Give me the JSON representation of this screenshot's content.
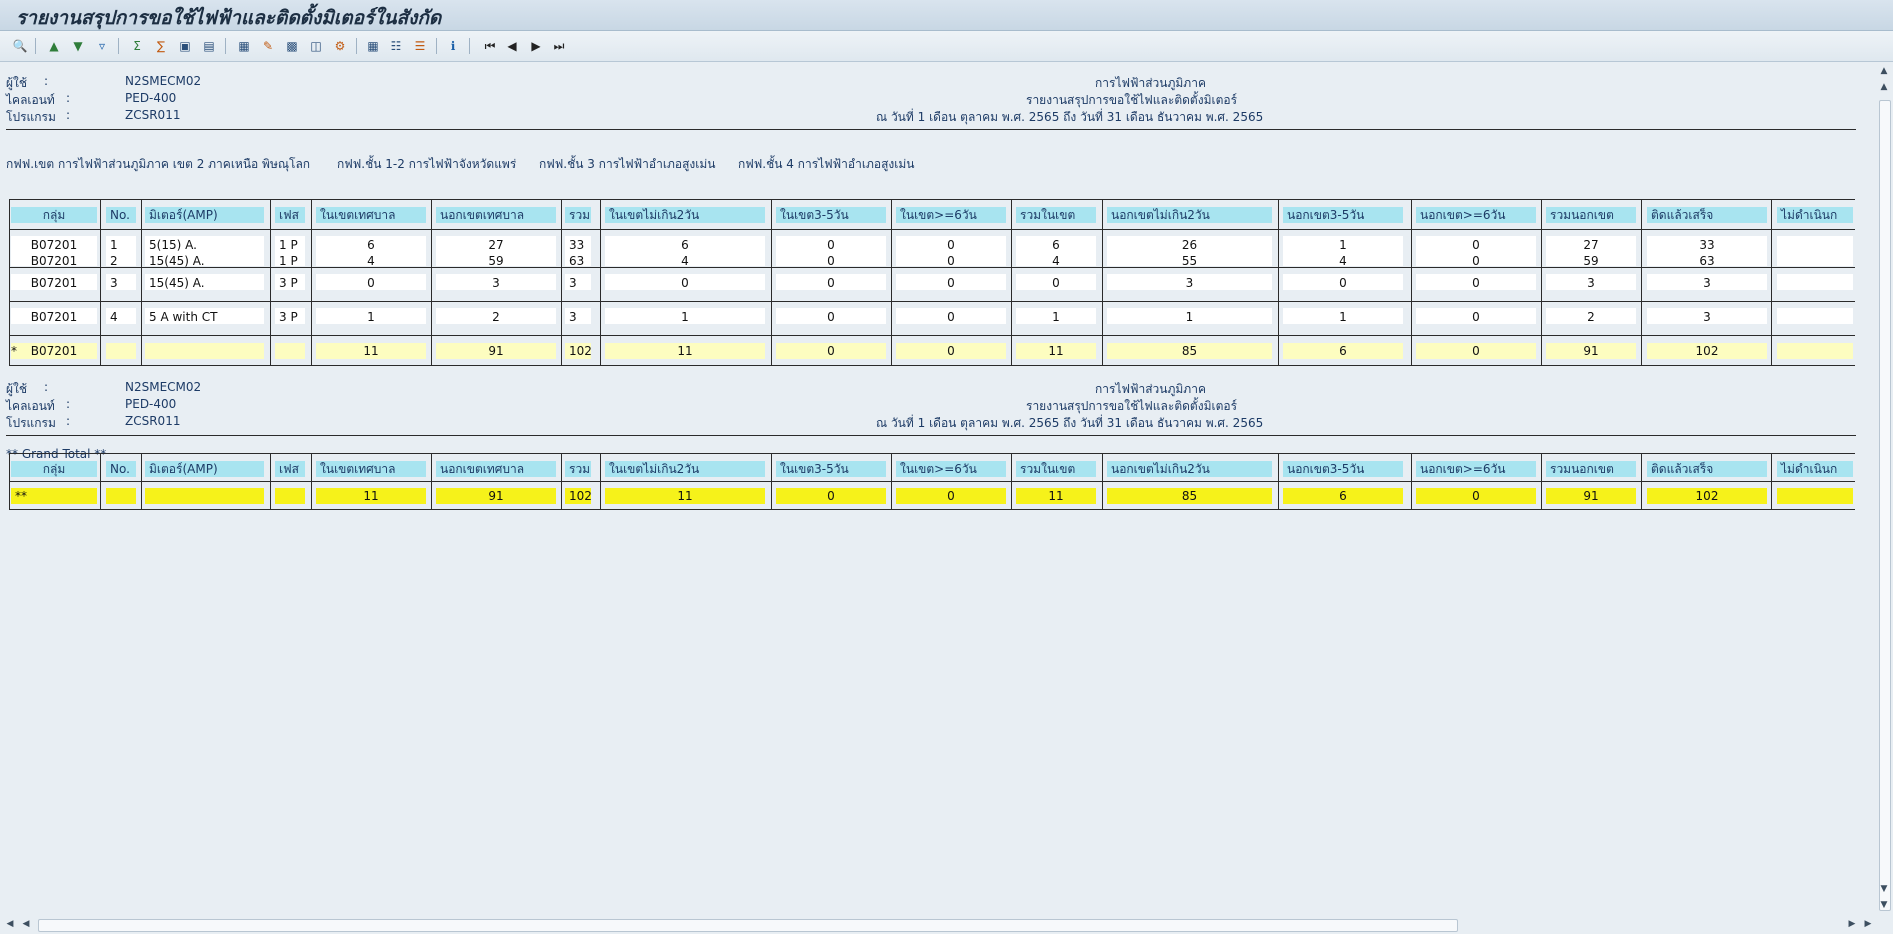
{
  "window": {
    "title": "รายงานสรุปการขอใช้ไฟฟ้าและติดตั้งมิเตอร์ในสังกัด"
  },
  "toolbar": {
    "icons": [
      "detail-icon",
      "sort-ascending-icon",
      "sort-descending-icon",
      "filter-icon",
      "total-icon",
      "subtotal-icon",
      "print-preview-icon",
      "export-icon",
      "graphic-icon",
      "word-processing-icon",
      "local-file-icon",
      "spreadsheet-icon",
      "change-layout-icon",
      "select-layout-icon",
      "save-layout-icon",
      "information-icon",
      "first-page-icon",
      "previous-page-icon",
      "next-page-icon",
      "last-page-icon"
    ]
  },
  "header_block": {
    "user_label": "ผู้ใช้",
    "user_colon": ":",
    "user_value": "N2SMECM02",
    "client_label": "ไคลเอนท์",
    "client_colon": ":",
    "client_value": "PED-400",
    "program_label": "โปรแกรม",
    "program_colon": ":",
    "program_value": "ZCSR011",
    "org": "การไฟฟ้าส่วนภูมิภาค",
    "report_title": "รายงานสรุปการขอใช้ไฟและติดตั้งมิเตอร์",
    "period": "ณ วันที่ 1 เดือน ตุลาคม พ.ศ. 2565 ถึง วันที่ 31 เดือน ธันวาคม พ.ศ. 2565"
  },
  "section1": {
    "breadcrumb": [
      "กฟฟ.เขต การไฟฟ้าส่วนภูมิภาค เขต 2 ภาคเหนือ พิษณุโลก",
      "กฟฟ.ชั้น 1-2 การไฟฟ้าจังหวัดแพร่",
      "กฟฟ.ชั้น 3 การไฟฟ้าอำเภอสูงเม่น",
      "กฟฟ.ชั้น 4 การไฟฟ้าอำเภอสูงเม่น"
    ]
  },
  "columns": [
    "กลุ่ม",
    "No.",
    "มิเตอร์(AMP)",
    "เฟส",
    "ในเขตเทศบาล",
    "นอกเขตเทศบาล",
    "รวม",
    "ในเขตไม่เกิน2วัน",
    "ในเขต3-5วัน",
    "ในเขต>=6วัน",
    "รวมในเขต",
    "นอกเขตไม่เกิน2วัน",
    "นอกเขต3-5วัน",
    "นอกเขต>=6วัน",
    "รวมนอกเขต",
    "ติดแล้วเสร็จ",
    "ไม่ดำเนินก"
  ],
  "rows": [
    [
      "B07201",
      "1",
      "5(15) A.",
      "1 P",
      "6",
      "27",
      "33",
      "6",
      "0",
      "0",
      "6",
      "26",
      "1",
      "0",
      "27",
      "33",
      ""
    ],
    [
      "B07201",
      "2",
      "15(45) A.",
      "1 P",
      "4",
      "59",
      "63",
      "4",
      "0",
      "0",
      "4",
      "55",
      "4",
      "0",
      "59",
      "63",
      ""
    ],
    [
      "B07201",
      "3",
      "15(45) A.",
      "3 P",
      "0",
      "3",
      "3",
      "0",
      "0",
      "0",
      "0",
      "3",
      "0",
      "0",
      "3",
      "3",
      ""
    ],
    [
      "B07201",
      "4",
      "5 A with CT",
      "3 P",
      "1",
      "2",
      "3",
      "1",
      "0",
      "0",
      "1",
      "1",
      "1",
      "0",
      "2",
      "3",
      ""
    ]
  ],
  "subtotal": {
    "marker": "*",
    "values": [
      "B07201",
      "",
      "",
      "",
      "11",
      "91",
      "102",
      "11",
      "0",
      "0",
      "11",
      "85",
      "6",
      "0",
      "91",
      "102",
      ""
    ]
  },
  "grand_total": {
    "label": "** Grand Total **",
    "values": [
      "**",
      "",
      "",
      "",
      "11",
      "91",
      "102",
      "11",
      "0",
      "0",
      "11",
      "85",
      "6",
      "0",
      "91",
      "102",
      ""
    ]
  },
  "colors": {
    "header_cell": "#a8e4f0",
    "subtotal_row": "#fdfdc0",
    "grand_total_row": "#f6f21a",
    "background": "#e8eef3"
  }
}
